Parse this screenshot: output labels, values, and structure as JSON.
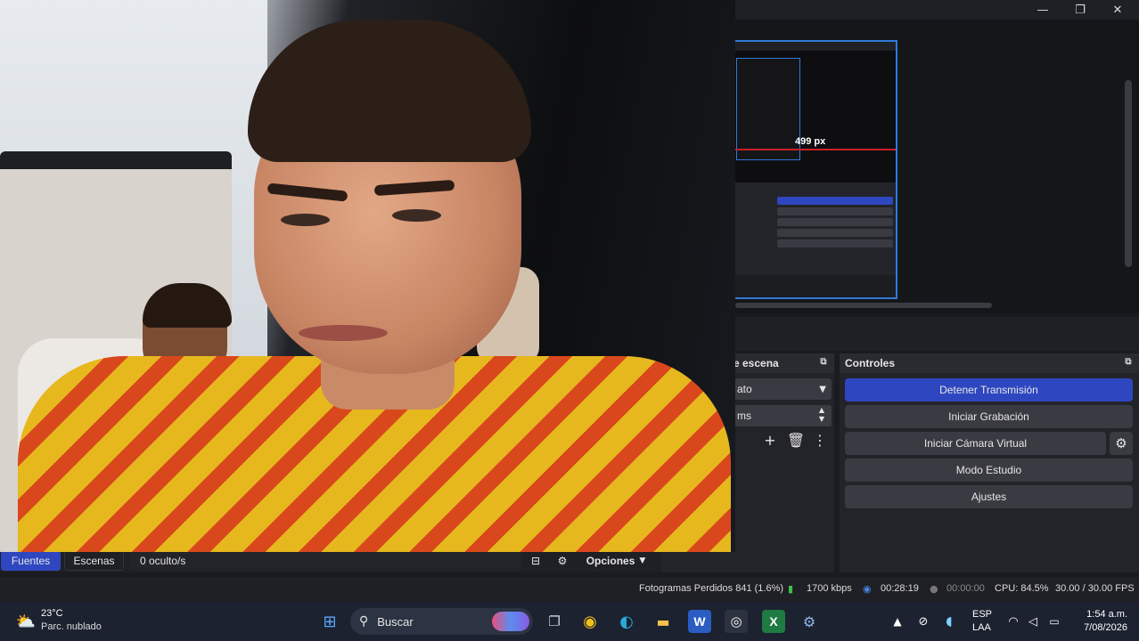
{
  "window": {
    "minimize_glyph": "—",
    "maximize_glyph": "❐",
    "close_glyph": "✕"
  },
  "preview": {
    "nested_measure_label": "499 px"
  },
  "scene_transitions": {
    "title_fragment": "e escena",
    "transition_value": "ato",
    "duration_value": "ms"
  },
  "controls": {
    "title": "Controles",
    "stop_stream": "Detener Transmisión",
    "start_recording": "Iniciar Grabación",
    "start_virtual_cam": "Iniciar Cámara Virtual",
    "studio_mode": "Modo Estudio",
    "settings": "Ajustes",
    "accent": "#2e47c0"
  },
  "docks": {
    "tab_sources": "Fuentes",
    "tab_scenes": "Escenas",
    "hidden_count": "0 oculto/s",
    "options": "Opciones"
  },
  "status": {
    "dropped_frames": "Fotogramas Perdidos 841 (1.6%)",
    "bitrate": "1700 kbps",
    "stream_time": "00:28:19",
    "record_time": "00:00:00",
    "cpu": "CPU: 84.5%",
    "fps": "30.00 / 30.00 FPS"
  },
  "taskbar": {
    "weather_temp": "23°C",
    "weather_desc": "Parc. nublado",
    "search_placeholder": "Buscar",
    "lang_line1": "ESP",
    "lang_line2": "LAA",
    "time": "1:54 a.m.",
    "date": "7/08/2026"
  }
}
